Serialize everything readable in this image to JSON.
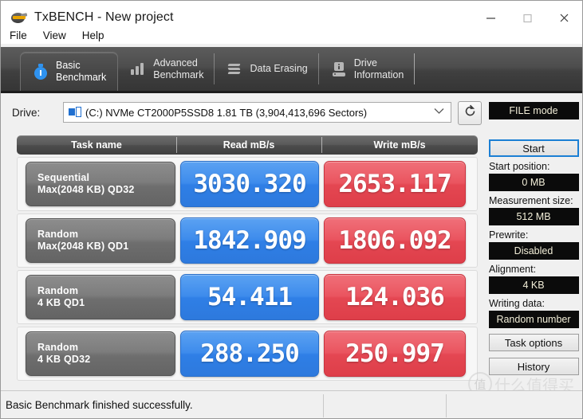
{
  "window": {
    "title": "TxBENCH - New project",
    "icon": "app-disc-icon",
    "minimize": "minimize-button",
    "maximize": "maximize-button",
    "close": "close-button"
  },
  "menu": {
    "items": [
      {
        "label": "File"
      },
      {
        "label": "View"
      },
      {
        "label": "Help"
      }
    ]
  },
  "tabs": [
    {
      "line1": "Basic",
      "line2": "Benchmark",
      "icon": "stopwatch-icon",
      "active": true
    },
    {
      "line1": "Advanced",
      "line2": "Benchmark",
      "icon": "bar-chart-icon",
      "active": false
    },
    {
      "line1": "Data Erasing",
      "line2": "",
      "icon": "erase-icon",
      "active": false
    },
    {
      "line1": "Drive",
      "line2": "Information",
      "icon": "drive-info-icon",
      "active": false
    }
  ],
  "drive": {
    "label": "Drive:",
    "selected": "(C:) NVMe CT2000P5SSD8  1.81 TB (3,904,413,696 Sectors)",
    "caret": "chevron-down-icon",
    "refresh": "refresh-icon"
  },
  "results": {
    "headers": [
      "Task name",
      "Read mB/s",
      "Write mB/s"
    ],
    "rows": [
      {
        "name_line1": "Sequential",
        "name_line2": "Max(2048 KB) QD32",
        "read": "3030.320",
        "write": "2653.117"
      },
      {
        "name_line1": "Random",
        "name_line2": "Max(2048 KB) QD1",
        "read": "1842.909",
        "write": "1806.092"
      },
      {
        "name_line1": "Random",
        "name_line2": "4 KB QD1",
        "read": "54.411",
        "write": "124.036"
      },
      {
        "name_line1": "Random",
        "name_line2": "4 KB QD32",
        "read": "288.250",
        "write": "250.997"
      }
    ]
  },
  "panel": {
    "mode_button": "FILE mode",
    "start_button": "Start",
    "start_position_label": "Start position:",
    "start_position_value": "0 MB",
    "measurement_size_label": "Measurement size:",
    "measurement_size_value": "512 MB",
    "prewrite_label": "Prewrite:",
    "prewrite_value": "Disabled",
    "alignment_label": "Alignment:",
    "alignment_value": "4 KB",
    "writing_data_label": "Writing data:",
    "writing_data_value": "Random number",
    "task_options_button": "Task options",
    "history_button": "History"
  },
  "status": {
    "message": "Basic Benchmark finished successfully."
  },
  "watermark": {
    "mark": "值",
    "text": "什么值得买"
  },
  "colors": {
    "read_blue": "#3d8bec",
    "write_red": "#ea545f",
    "tab_dark": "#4d4d4d",
    "accent_focus": "#1b7fd4",
    "value_dark_bg": "#0b0b0b",
    "value_dark_fg": "#f2eed8"
  }
}
